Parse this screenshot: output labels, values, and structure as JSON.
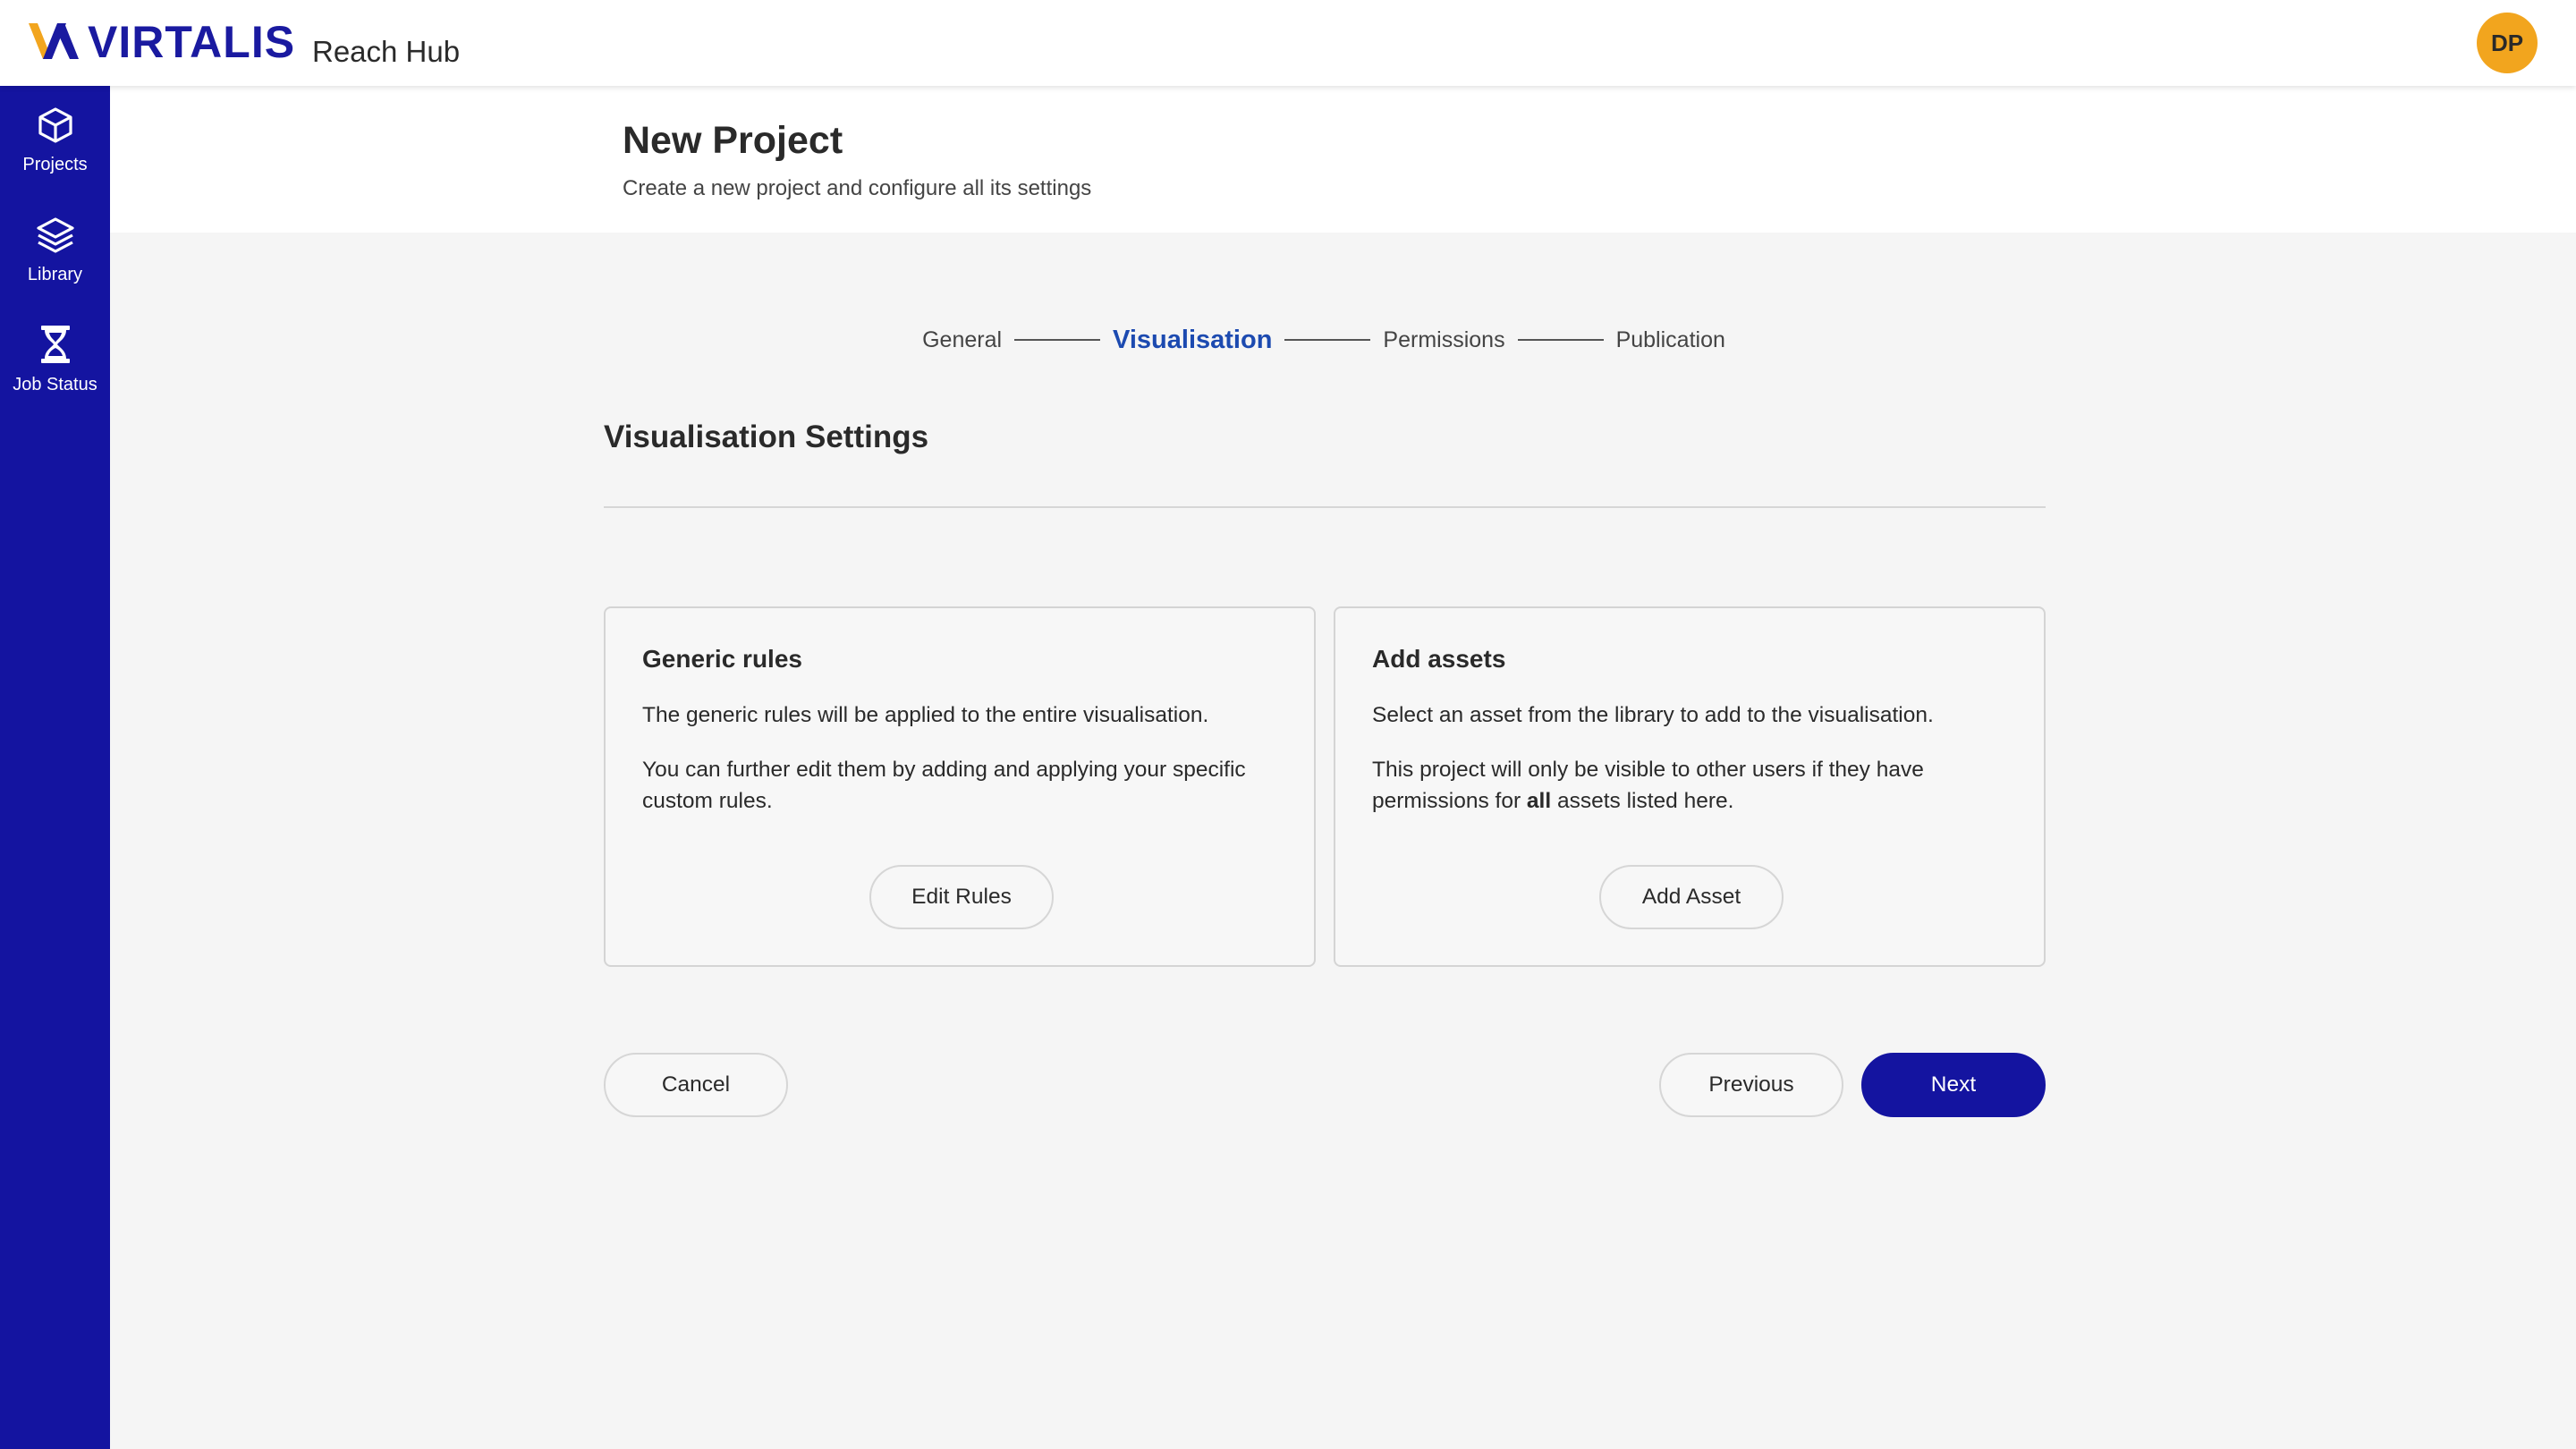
{
  "app": {
    "brand": "VIRTALIS",
    "product": "Reach Hub",
    "user_initials": "DP",
    "colors": {
      "primary": "#1414a0",
      "accent": "#f2a51e",
      "active_step": "#1c4ab0"
    }
  },
  "sidebar": {
    "items": [
      {
        "label": "Projects",
        "icon": "cube-icon"
      },
      {
        "label": "Library",
        "icon": "layers-icon"
      },
      {
        "label": "Job Status",
        "icon": "hourglass-icon"
      }
    ]
  },
  "page": {
    "title": "New Project",
    "subtitle": "Create a new project and configure all its settings"
  },
  "stepper": {
    "steps": [
      "General",
      "Visualisation",
      "Permissions",
      "Publication"
    ],
    "active_index": 1
  },
  "section": {
    "title": "Visualisation Settings"
  },
  "cards": {
    "rules": {
      "title": "Generic rules",
      "text1": "The generic rules will be applied to the entire visualisation.",
      "text2": "You can further edit them by adding and applying your specific custom rules.",
      "button": "Edit Rules"
    },
    "assets": {
      "title": "Add assets",
      "text1": "Select an asset from the library to add to the visualisation.",
      "text2_before": "This project will only be visible to other users if they have permissions for ",
      "text2_bold": "all",
      "text2_after": " assets listed here.",
      "button": "Add Asset"
    }
  },
  "footer": {
    "cancel": "Cancel",
    "previous": "Previous",
    "next": "Next"
  }
}
